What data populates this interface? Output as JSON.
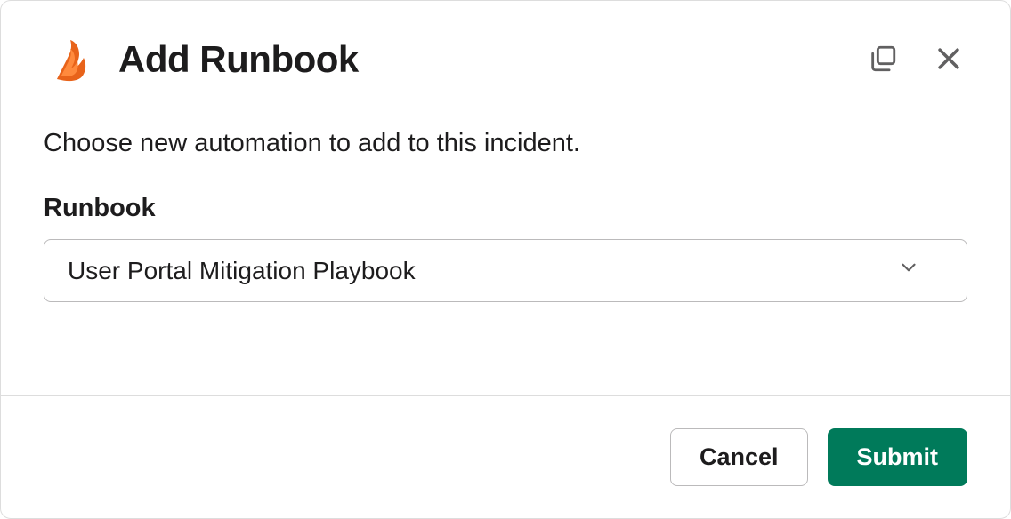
{
  "header": {
    "title": "Add Runbook"
  },
  "content": {
    "description": "Choose new automation to add to this incident.",
    "field_label": "Runbook",
    "selected_value": "User Portal Mitigation Playbook"
  },
  "footer": {
    "cancel_label": "Cancel",
    "submit_label": "Submit"
  }
}
